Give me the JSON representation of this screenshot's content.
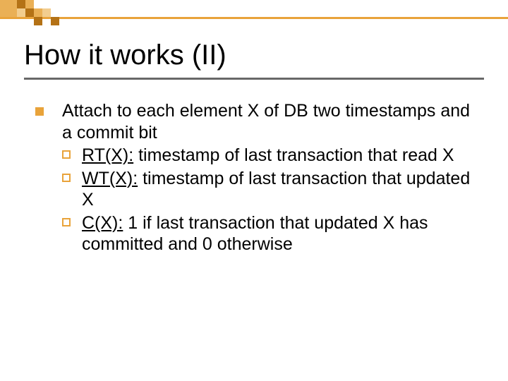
{
  "title": "How it works (II)",
  "body": {
    "main": "Attach to each element X of DB two timestamps and a commit bit",
    "items": [
      {
        "term": "RT(X):",
        "desc": " timestamp of last transaction that read X"
      },
      {
        "term": "WT(X):",
        "desc": " timestamp of last transaction that updated X"
      },
      {
        "term": "C(X):",
        "desc": " 1 if last transaction that updated X has committed and 0 otherwise"
      }
    ]
  }
}
